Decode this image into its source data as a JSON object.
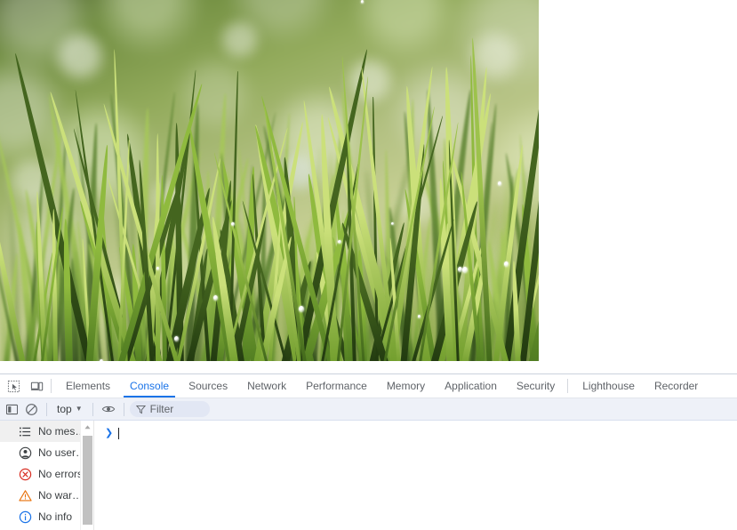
{
  "page": {
    "photo_alt": "close-up photo of dew-covered green grass blades with blurred bokeh background"
  },
  "devtools": {
    "left_buttons": [
      {
        "name": "inspect-element-icon",
        "title": "Inspect element"
      },
      {
        "name": "device-toolbar-icon",
        "title": "Toggle device toolbar"
      }
    ],
    "tabs": [
      {
        "label": "Elements",
        "active": false
      },
      {
        "label": "Console",
        "active": true
      },
      {
        "label": "Sources",
        "active": false
      },
      {
        "label": "Network",
        "active": false
      },
      {
        "label": "Performance",
        "active": false
      },
      {
        "label": "Memory",
        "active": false
      },
      {
        "label": "Application",
        "active": false
      },
      {
        "label": "Security",
        "active": false
      },
      {
        "label": "Lighthouse",
        "active": false
      },
      {
        "label": "Recorder",
        "active": false
      }
    ],
    "console_toolbar": {
      "sidebar_toggle": "Show console sidebar",
      "clear_console": "Clear console",
      "context_selector": "top",
      "context_caret": "▼",
      "live_expression": "Create live expression",
      "filter_placeholder": "Filter"
    },
    "console_sidebar": [
      {
        "icon": "list-icon",
        "label": "No mes…",
        "selected": true
      },
      {
        "icon": "user-circle-icon",
        "label": "No user…",
        "selected": false
      },
      {
        "icon": "error-circle-icon",
        "label": "No errors",
        "selected": false
      },
      {
        "icon": "warning-triangle-icon",
        "label": "No war…",
        "selected": false
      },
      {
        "icon": "info-circle-icon",
        "label": "No info",
        "selected": false
      }
    ],
    "console_prompt": {
      "caret": "❯",
      "value": ""
    }
  },
  "colors": {
    "accent_blue": "#1a73e8",
    "error_red": "#d93025",
    "warning_orange": "#e8710a",
    "info_blue": "#1a73e8",
    "toolbar_bg": "#eef1f8",
    "selected_row": "#f0f0f0",
    "scroll_thumb": "#c1c1c1"
  }
}
